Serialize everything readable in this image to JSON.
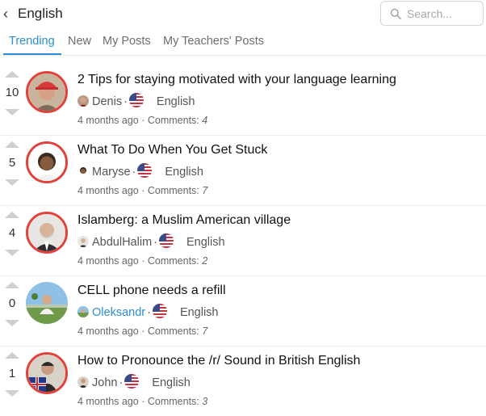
{
  "header": {
    "title": "English",
    "back_icon": "chevron-left-icon"
  },
  "search": {
    "placeholder": "Search...",
    "value": ""
  },
  "tabs": [
    {
      "label": "Trending",
      "active": true
    },
    {
      "label": "New",
      "active": false
    },
    {
      "label": "My Posts",
      "active": false
    },
    {
      "label": "My Teachers' Posts",
      "active": false
    }
  ],
  "posts": [
    {
      "score": "10",
      "title": "2 Tips for staying motivated with your language learning",
      "author": "Denis",
      "language": "English",
      "age": "4 months ago",
      "comments_label": "Comments:",
      "comments": "4"
    },
    {
      "score": "5",
      "title": "What To Do When You Get Stuck",
      "author": "Maryse",
      "language": "English",
      "age": "4 months ago",
      "comments_label": "Comments:",
      "comments": "7"
    },
    {
      "score": "4",
      "title": "Islamberg: a Muslim American village",
      "author": "AbdulHalim",
      "language": "English",
      "age": "4 months ago",
      "comments_label": "Comments:",
      "comments": "2"
    },
    {
      "score": "0",
      "title": "CELL phone needs a refill",
      "author": "Oleksandr",
      "language": "English",
      "age": "4 months ago",
      "comments_label": "Comments:",
      "comments": "7"
    },
    {
      "score": "1",
      "title": "How to Pronounce the /r/ Sound in British English",
      "author": "John",
      "language": "English",
      "age": "4 months ago",
      "comments_label": "Comments:",
      "comments": "3"
    }
  ],
  "colors": {
    "accent": "#2a8fd6",
    "avatar_ring": "#e2413b",
    "vote_arrow": "#cfcfcf"
  }
}
